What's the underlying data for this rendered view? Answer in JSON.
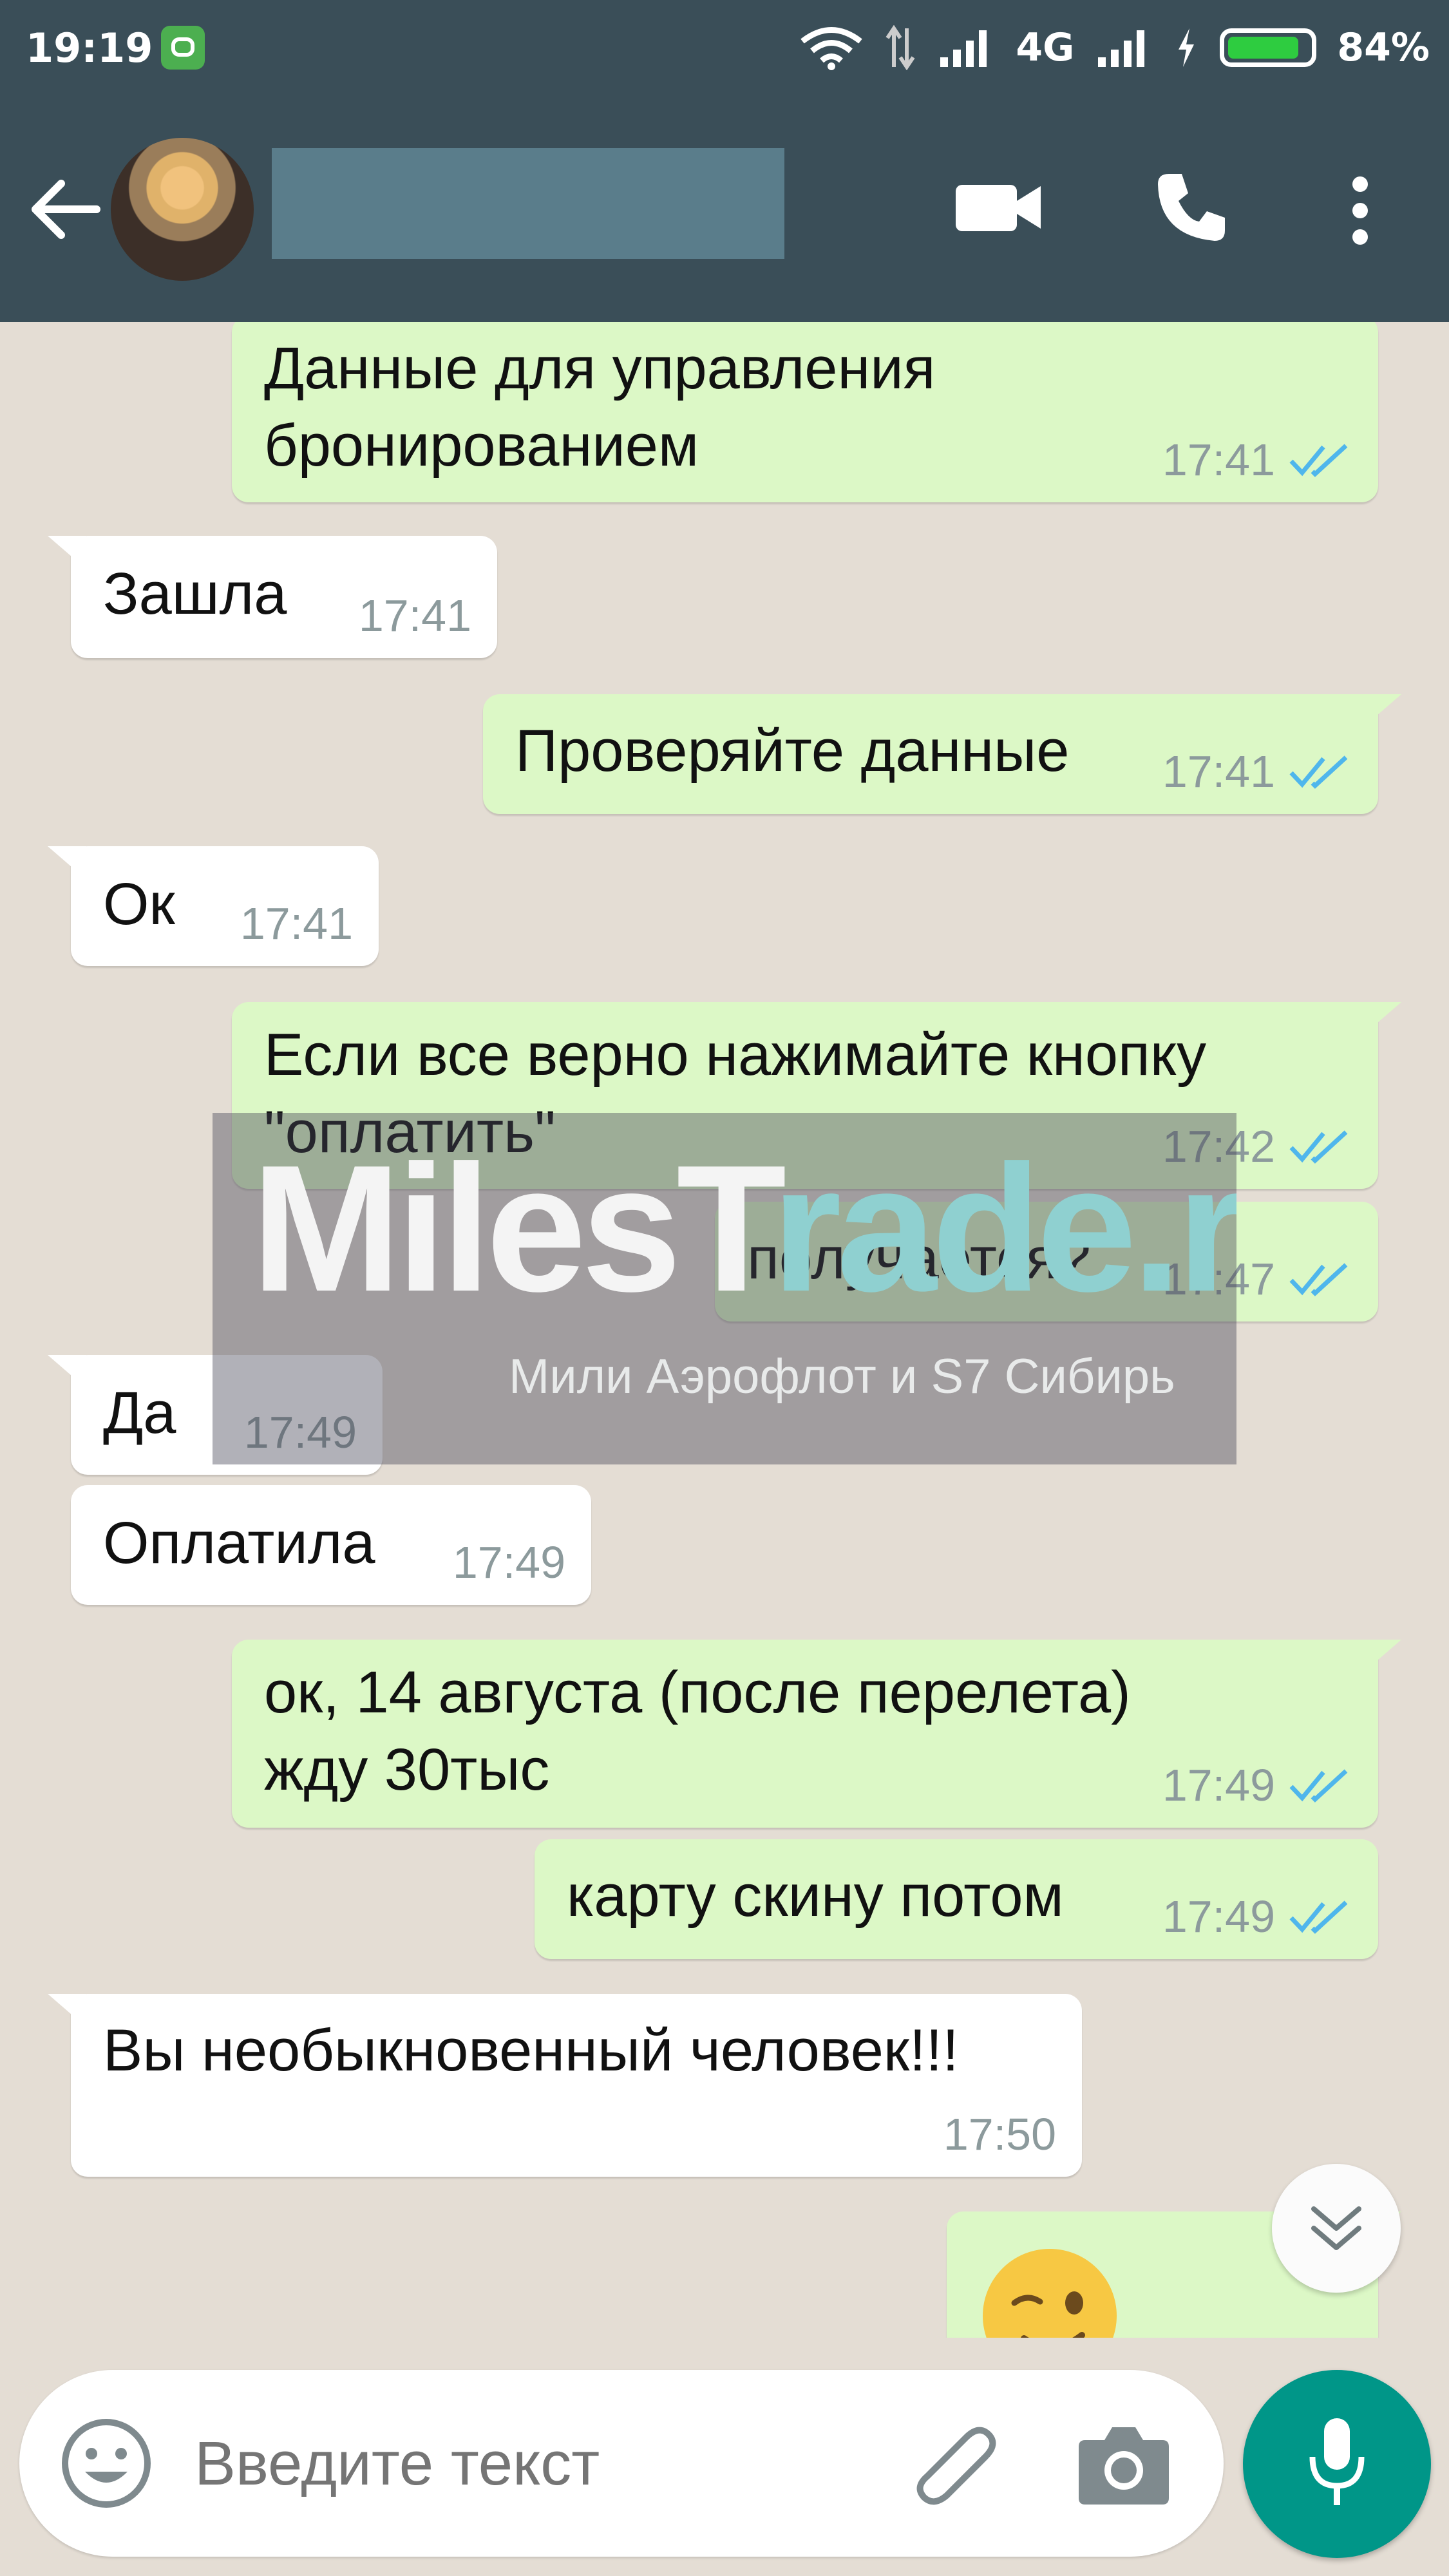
{
  "status_bar": {
    "time": "19:19",
    "network": "4G",
    "battery": "84%",
    "battery_level": 0.84
  },
  "header": {
    "contact_name": "",
    "icons": [
      "back-arrow-icon",
      "video-call-icon",
      "phone-icon",
      "more-vert-icon"
    ]
  },
  "messages": [
    {
      "dir": "out",
      "lines": [
        "Данные для управления",
        "бронированием"
      ],
      "time": "17:41",
      "status": "read"
    },
    {
      "dir": "in",
      "lines": [
        "Зашла"
      ],
      "time": "17:41"
    },
    {
      "dir": "out",
      "lines": [
        "Проверяйте данные"
      ],
      "time": "17:41",
      "status": "read"
    },
    {
      "dir": "in",
      "lines": [
        "Ок"
      ],
      "time": "17:41"
    },
    {
      "dir": "out",
      "lines": [
        "Если все верно нажимайте кнопку",
        "\"оплатить\""
      ],
      "time": "17:42",
      "status": "read"
    },
    {
      "dir": "out",
      "lines": [
        "получается?"
      ],
      "time": "17:47",
      "status": "read"
    },
    {
      "dir": "in",
      "lines": [
        "Да"
      ],
      "time": "17:49"
    },
    {
      "dir": "in",
      "lines": [
        "Оплатила"
      ],
      "time": "17:49"
    },
    {
      "dir": "out",
      "lines": [
        "ок, 14 августа (после перелета)",
        "жду 30тыс"
      ],
      "time": "17:49",
      "status": "read"
    },
    {
      "dir": "out",
      "lines": [
        "карту скину потом"
      ],
      "time": "17:49",
      "status": "read"
    },
    {
      "dir": "in",
      "lines": [
        "Вы необыкновенный человек!!!"
      ],
      "time": "17:50"
    },
    {
      "dir": "out",
      "emoji": "winking-face-emoji"
    }
  ],
  "watermark": {
    "logo_part1": "MilesT",
    "logo_part2": "rade.ru",
    "tagline": "Мили Аэрофлот и S7 Сибирь"
  },
  "composer": {
    "placeholder": "Введите текст",
    "icons": [
      "emoji-icon",
      "attach-icon",
      "camera-icon",
      "mic-icon"
    ]
  },
  "colors": {
    "header": "#3a4e58",
    "outgoing_bubble": "#dcf8c6",
    "incoming_bubble": "#ffffff",
    "read_check": "#4fb6ec",
    "mic_button": "#009688"
  }
}
